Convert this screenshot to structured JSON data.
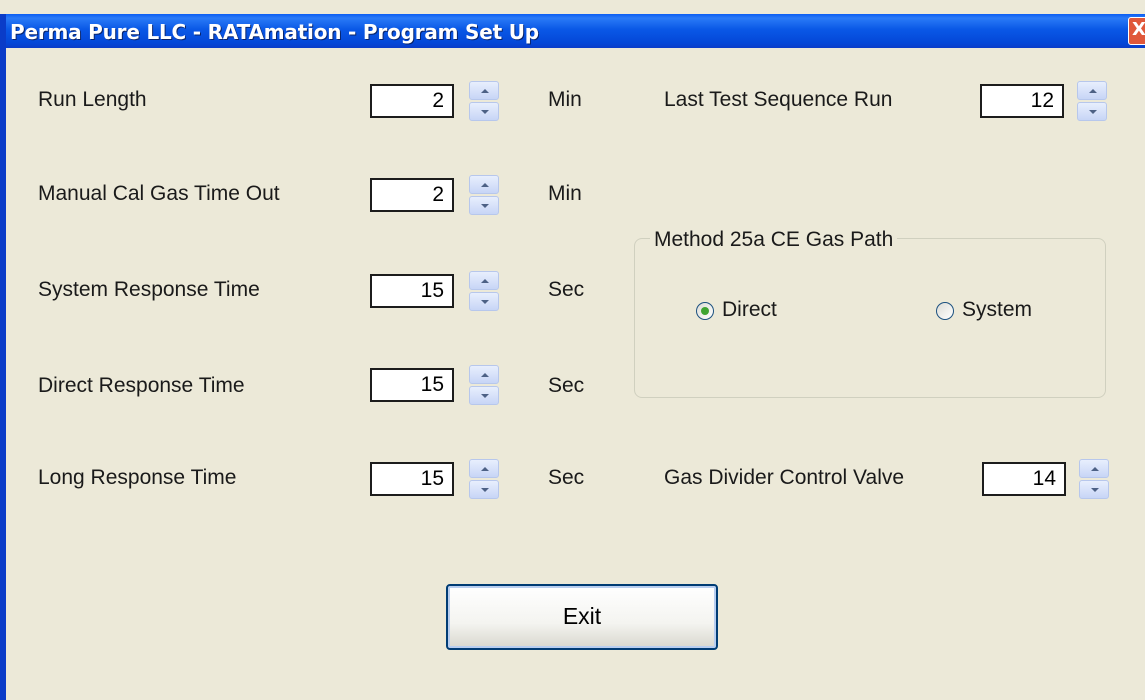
{
  "window": {
    "title": "Perma Pure LLC - RATAmation - Program Set Up",
    "close_glyph": "X"
  },
  "fields": [
    {
      "label": "Run Length",
      "value": "2",
      "unit": "Min"
    },
    {
      "label": "Manual Cal Gas Time Out",
      "value": "2",
      "unit": "Min"
    },
    {
      "label": "System Response Time",
      "value": "15",
      "unit": "Sec"
    },
    {
      "label": "Direct Response Time",
      "value": "15",
      "unit": "Sec"
    },
    {
      "label": "Long Response Time",
      "value": "15",
      "unit": "Sec"
    }
  ],
  "last_test": {
    "label": "Last Test Sequence Run",
    "value": "12"
  },
  "gas_divider": {
    "label": "Gas Divider Control Valve",
    "value": "14"
  },
  "gas_path_group": {
    "title": "Method 25a CE Gas Path",
    "options": [
      {
        "label": "Direct",
        "selected": true
      },
      {
        "label": "System",
        "selected": false
      }
    ]
  },
  "exit_button": {
    "label": "Exit"
  },
  "colors": {
    "titlebar": "#0a58e6",
    "background": "#ece9d8",
    "radio_selected": "#3fa432"
  }
}
